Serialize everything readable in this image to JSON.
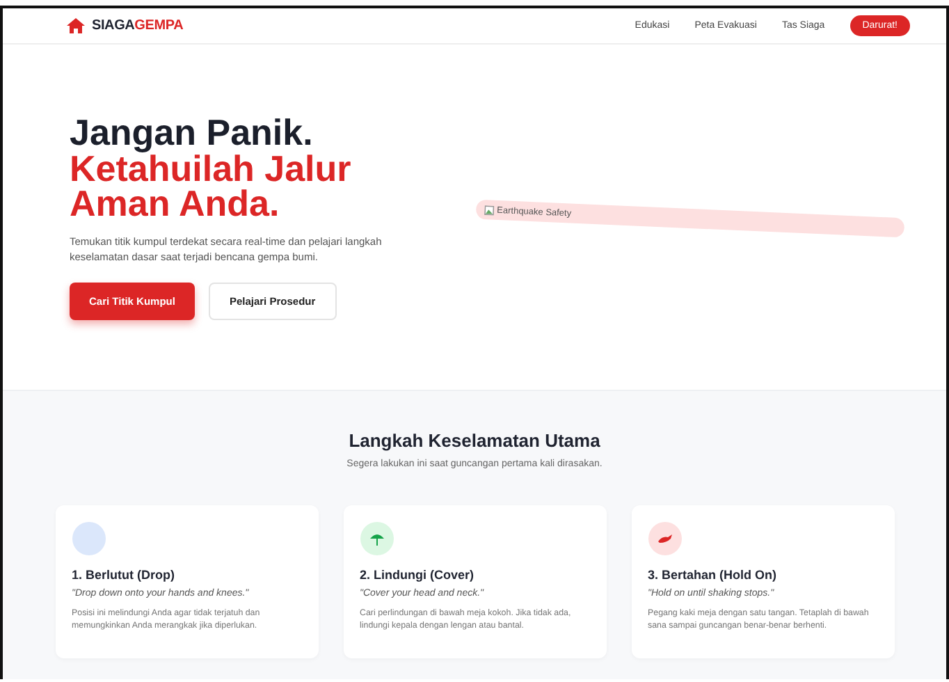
{
  "brand": {
    "dark": "SIAGA",
    "accent": "GEMPA"
  },
  "nav": {
    "links": [
      "Edukasi",
      "Peta Evakuasi",
      "Tas Siaga"
    ],
    "cta": "Darurat!"
  },
  "hero": {
    "title_line": "Jangan Panik.",
    "accent_line": "Ketahuilah Jalur Aman Anda.",
    "text": "Temukan titik kumpul terdekat secara real-time dan pelajari langkah keselamatan dasar saat terjadi bencana gempa bumi.",
    "primary_button": "Cari Titik Kumpul",
    "secondary_button": "Pelajari Prosedur",
    "image_alt": "Earthquake Safety"
  },
  "steps": {
    "title": "Langkah Keselamatan Utama",
    "subtitle": "Segera lakukan ini saat guncangan pertama kali dirasakan.",
    "cards": [
      {
        "kind": "drop",
        "title": "1. Berlutut (Drop)",
        "quote": "\"Drop down onto your hands and knees.\"",
        "text": "Posisi ini melindungi Anda agar tidak terjatuh dan memungkinkan Anda merangkak jika diperlukan."
      },
      {
        "kind": "cover",
        "title": "2. Lindungi (Cover)",
        "quote": "\"Cover your head and neck.\"",
        "text": "Cari perlindungan di bawah meja kokoh. Jika tidak ada, lindungi kepala dengan lengan atau bantal."
      },
      {
        "kind": "hold",
        "title": "3. Bertahan (Hold On)",
        "quote": "\"Hold on until shaking stops.\"",
        "text": "Pegang kaki meja dengan satu tangan. Tetaplah di bawah sana sampai guncangan benar-benar berhenti."
      }
    ]
  }
}
